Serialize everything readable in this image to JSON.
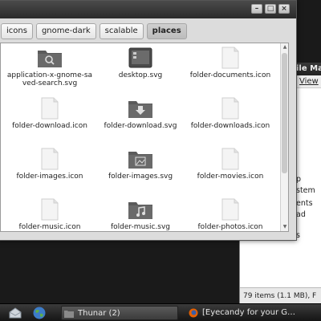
{
  "background_window": {
    "title_fragment": "ile Ma",
    "menu_fragment": "View",
    "side_rows": [
      "p",
      "stem",
      "ents",
      "ad",
      "s"
    ],
    "status_text": "79 items (1.1 MB), F"
  },
  "window": {
    "controls": [
      "minimize",
      "maximize",
      "close"
    ],
    "pathbar": [
      {
        "label": "icons",
        "active": false
      },
      {
        "label": "gnome-dark",
        "active": false
      },
      {
        "label": "scalable",
        "active": false
      },
      {
        "label": "places",
        "active": true
      }
    ],
    "files": [
      {
        "name": "application-x-gnome-saved-search.svg",
        "icon": "saved-search-folder-icon"
      },
      {
        "name": "desktop.svg",
        "icon": "desktop-icon"
      },
      {
        "name": "folder-documents.icon",
        "icon": "blank-file-icon"
      },
      {
        "name": "folder-download.icon",
        "icon": "blank-file-icon"
      },
      {
        "name": "folder-download.svg",
        "icon": "download-folder-icon"
      },
      {
        "name": "folder-downloads.icon",
        "icon": "blank-file-icon"
      },
      {
        "name": "folder-images.icon",
        "icon": "blank-file-icon"
      },
      {
        "name": "folder-images.svg",
        "icon": "images-folder-icon"
      },
      {
        "name": "folder-movies.icon",
        "icon": "blank-file-icon"
      },
      {
        "name": "folder-music.icon",
        "icon": "blank-file-icon"
      },
      {
        "name": "folder-music.svg",
        "icon": "music-folder-icon"
      },
      {
        "name": "folder-photos.icon",
        "icon": "blank-file-icon"
      },
      {
        "name": "",
        "icon": "blank-file-icon"
      },
      {
        "name": "",
        "icon": "images-folder-icon"
      },
      {
        "name": "",
        "icon": "blank-file-icon"
      }
    ]
  },
  "taskbar": {
    "launchers": [
      "mail-icon",
      "globe-icon"
    ],
    "tasks": [
      {
        "label": "Thunar (2)",
        "icon": "folder-icon",
        "active": true
      },
      {
        "label": "[Eyecandy for your G…",
        "icon": "firefox-icon",
        "active": false
      }
    ]
  },
  "colors": {
    "folder_dark": "#555555",
    "taskbar": "#1f1f1f",
    "accent_firefox": "#e66000"
  }
}
